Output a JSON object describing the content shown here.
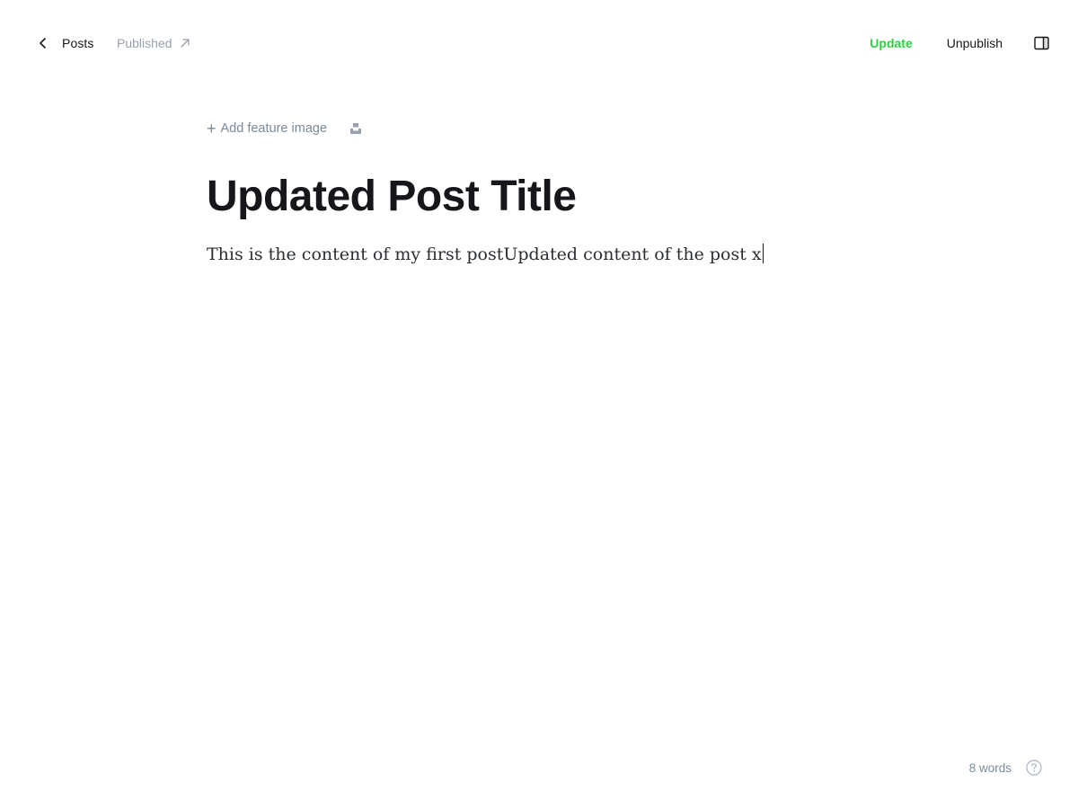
{
  "header": {
    "back_label": "Posts",
    "status_label": "Published",
    "update_label": "Update",
    "unpublish_label": "Unpublish"
  },
  "editor": {
    "add_feature_image_label": "Add feature image",
    "title": "Updated Post Title",
    "body": "This is the content of my first postUpdated content of the post x"
  },
  "footer": {
    "word_count": "8 words"
  },
  "colors": {
    "accent_green": "#30cf43",
    "muted": "#7c8b9a",
    "text": "#15171a"
  },
  "icons": {
    "back": "chevron-left-icon",
    "external": "arrow-up-right-icon",
    "sidebar": "sidebar-toggle-icon",
    "unsplash": "unsplash-icon",
    "help": "question-circle-icon"
  }
}
